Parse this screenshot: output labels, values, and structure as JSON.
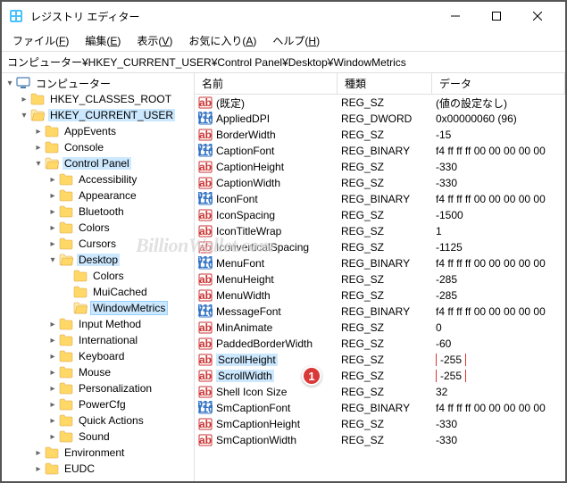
{
  "window": {
    "title": "レジストリ エディター"
  },
  "menu": {
    "file": "ファイル(F)",
    "edit": "編集(E)",
    "view": "表示(V)",
    "fav": "お気に入り(A)",
    "help": "ヘルプ(H)"
  },
  "address": "コンピューター¥HKEY_CURRENT_USER¥Control Panel¥Desktop¥WindowMetrics",
  "tree": {
    "root": "コンピューター",
    "hkcr": "HKEY_CLASSES_ROOT",
    "hkcu": "HKEY_CURRENT_USER",
    "hkcu_children": [
      "AppEvents",
      "Console",
      "Control Panel"
    ],
    "cp_children": [
      "Accessibility",
      "Appearance",
      "Bluetooth",
      "Colors",
      "Cursors",
      "Desktop"
    ],
    "desktop_children": [
      "Colors",
      "MuiCached",
      "WindowMetrics"
    ],
    "hkcu_after_cp": [
      "Input Method",
      "International",
      "Keyboard",
      "Mouse",
      "Personalization",
      "PowerCfg",
      "Quick Actions",
      "Sound"
    ],
    "hkcu_tail": [
      "Environment",
      "EUDC"
    ]
  },
  "columns": {
    "name": "名前",
    "type": "種類",
    "data": "データ"
  },
  "rows": [
    {
      "icon": "sz",
      "name": "(既定)",
      "type": "REG_SZ",
      "data": "(値の設定なし)"
    },
    {
      "icon": "bin",
      "name": "AppliedDPI",
      "type": "REG_DWORD",
      "data": "0x00000060 (96)"
    },
    {
      "icon": "sz",
      "name": "BorderWidth",
      "type": "REG_SZ",
      "data": "-15"
    },
    {
      "icon": "bin",
      "name": "CaptionFont",
      "type": "REG_BINARY",
      "data": "f4 ff ff ff 00 00 00 00 00"
    },
    {
      "icon": "sz",
      "name": "CaptionHeight",
      "type": "REG_SZ",
      "data": "-330"
    },
    {
      "icon": "sz",
      "name": "CaptionWidth",
      "type": "REG_SZ",
      "data": "-330"
    },
    {
      "icon": "bin",
      "name": "IconFont",
      "type": "REG_BINARY",
      "data": "f4 ff ff ff 00 00 00 00 00"
    },
    {
      "icon": "sz",
      "name": "IconSpacing",
      "type": "REG_SZ",
      "data": "-1500"
    },
    {
      "icon": "sz",
      "name": "IconTitleWrap",
      "type": "REG_SZ",
      "data": "1"
    },
    {
      "icon": "sz",
      "name": "IconverticalSpacing",
      "type": "REG_SZ",
      "data": "-1125"
    },
    {
      "icon": "bin",
      "name": "MenuFont",
      "type": "REG_BINARY",
      "data": "f4 ff ff ff 00 00 00 00 00"
    },
    {
      "icon": "sz",
      "name": "MenuHeight",
      "type": "REG_SZ",
      "data": "-285"
    },
    {
      "icon": "sz",
      "name": "MenuWidth",
      "type": "REG_SZ",
      "data": "-285"
    },
    {
      "icon": "bin",
      "name": "MessageFont",
      "type": "REG_BINARY",
      "data": "f4 ff ff ff 00 00 00 00 00"
    },
    {
      "icon": "sz",
      "name": "MinAnimate",
      "type": "REG_SZ",
      "data": "0"
    },
    {
      "icon": "sz",
      "name": "PaddedBorderWidth",
      "type": "REG_SZ",
      "data": "-60"
    },
    {
      "icon": "sz",
      "name": "ScrollHeight",
      "type": "REG_SZ",
      "data": "-255",
      "sel": true,
      "redData": true
    },
    {
      "icon": "sz",
      "name": "ScrollWidth",
      "type": "REG_SZ",
      "data": "-255",
      "sel": true,
      "redData": true,
      "badge": "1"
    },
    {
      "icon": "sz",
      "name": "Shell Icon Size",
      "type": "REG_SZ",
      "data": "32"
    },
    {
      "icon": "bin",
      "name": "SmCaptionFont",
      "type": "REG_BINARY",
      "data": "f4 ff ff ff 00 00 00 00 00"
    },
    {
      "icon": "sz",
      "name": "SmCaptionHeight",
      "type": "REG_SZ",
      "data": "-330"
    },
    {
      "icon": "sz",
      "name": "SmCaptionWidth",
      "type": "REG_SZ",
      "data": "-330"
    }
  ],
  "watermark": "BillionWallet.com"
}
